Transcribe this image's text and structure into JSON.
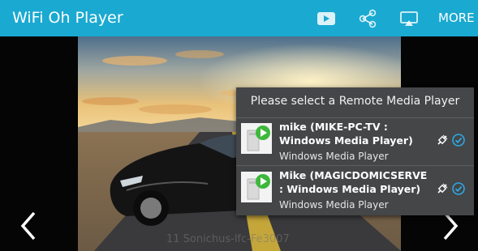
{
  "app": {
    "title": "WiFi Oh Player",
    "more_label": "MORE",
    "toolbar_icons": [
      "youtube-icon",
      "share-icon",
      "cast-icon"
    ],
    "accent": "#1aa9d1"
  },
  "watermark": "11 Sonichus-lfc-Fe3007",
  "dialog": {
    "title": "Please select a Remote Media Player",
    "devices": [
      {
        "name": "mike (MIKE-PC-TV : Windows Media Player)",
        "type": "Windows Media Player",
        "selected": true
      },
      {
        "name": "Mike (MAGICDOMICSERVE : Windows Media Player)",
        "type": "Windows Media Player",
        "selected": true
      }
    ]
  },
  "colors": {
    "check": "#2ea7e0",
    "play_green": "#3db83b"
  }
}
